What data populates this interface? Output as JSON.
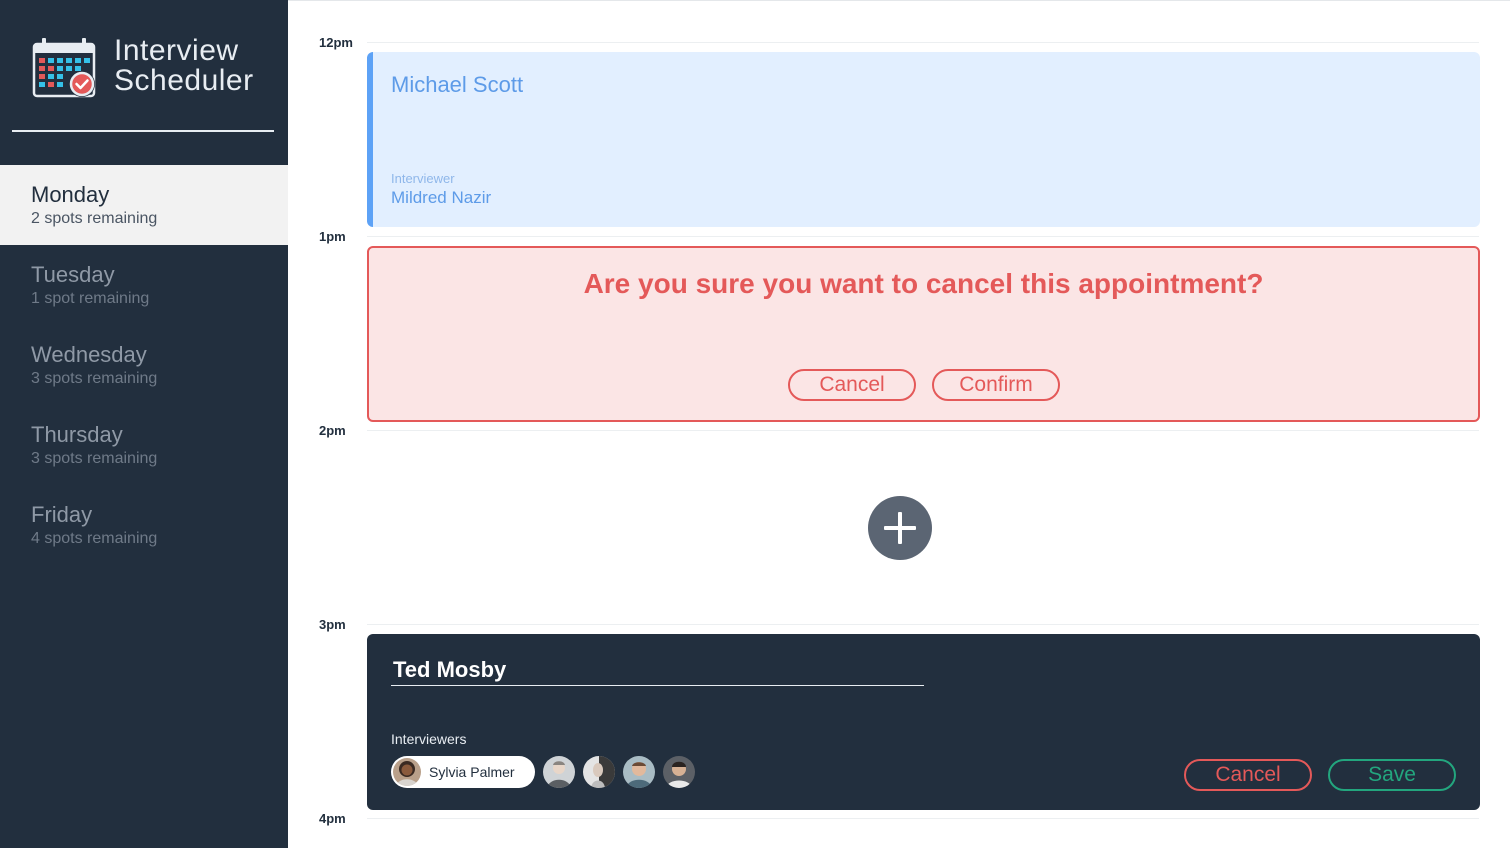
{
  "app": {
    "title_line1": "Interview",
    "title_line2": "Scheduler"
  },
  "sidebar": {
    "days": [
      {
        "name": "Monday",
        "spots": "2 spots remaining",
        "selected": true
      },
      {
        "name": "Tuesday",
        "spots": "1 spot remaining",
        "selected": false
      },
      {
        "name": "Wednesday",
        "spots": "3 spots remaining",
        "selected": false
      },
      {
        "name": "Thursday",
        "spots": "3 spots remaining",
        "selected": false
      },
      {
        "name": "Friday",
        "spots": "4 spots remaining",
        "selected": false
      }
    ]
  },
  "schedule": {
    "times": [
      "12pm",
      "1pm",
      "2pm",
      "3pm",
      "4pm"
    ],
    "show": {
      "student": "Michael Scott",
      "interviewer_label": "Interviewer",
      "interviewer_name": "Mildred Nazir"
    },
    "confirm": {
      "message": "Are you sure you want to cancel this appointment?",
      "cancel_label": "Cancel",
      "confirm_label": "Confirm"
    },
    "empty": {
      "add_icon": "plus-icon"
    },
    "form": {
      "student_value": "Ted Mosby",
      "interviewers_label": "Interviewers",
      "selected_interviewer": "Sylvia Palmer",
      "cancel_label": "Cancel",
      "save_label": "Save"
    }
  },
  "colors": {
    "sidebar_bg": "#222f3e",
    "show_bg": "#e2efff",
    "show_accent": "#5da2f6",
    "confirm_bg": "#fbe5e5",
    "danger": "#e45959",
    "success": "#23a67e"
  }
}
